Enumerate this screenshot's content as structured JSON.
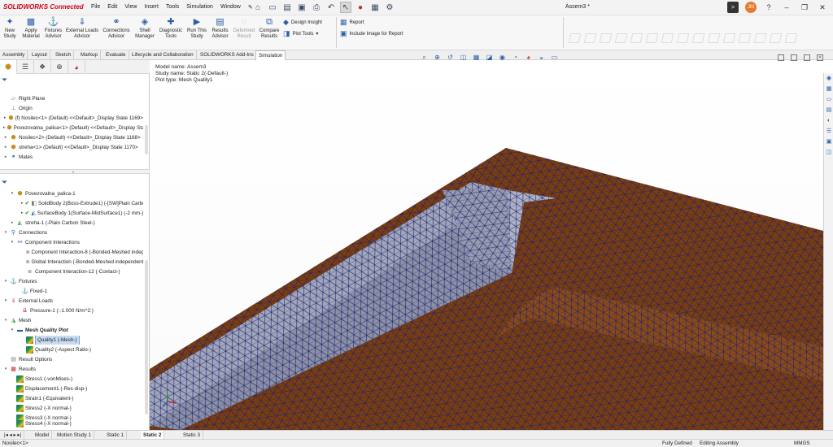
{
  "app": {
    "logo_text": "SOLIDWORKS Connected",
    "document_title": "Assem3 *"
  },
  "menu": [
    "File",
    "Edit",
    "View",
    "Insert",
    "Tools",
    "Simulation",
    "Window"
  ],
  "quick_tools": [
    "home-icon",
    "new-doc-icon",
    "open-icon",
    "save-icon",
    "print-icon",
    "undo-icon",
    "select-icon",
    "traffic-light-icon",
    "rebuild-icon",
    "options-icon"
  ],
  "window_controls": {
    "avatar": "JM"
  },
  "ribbon": {
    "buttons": [
      {
        "label": "New Study",
        "icon": "new-study-icon"
      },
      {
        "label": "Apply Material",
        "icon": "material-icon"
      },
      {
        "label": "Fixtures Advisor",
        "icon": "fixture-icon"
      },
      {
        "label": "External Loads Advisor",
        "icon": "load-icon"
      },
      {
        "label": "Connections Advisor",
        "icon": "connection-icon"
      },
      {
        "label": "Shell Manager",
        "icon": "shell-icon"
      },
      {
        "label": "Diagnostic Tools",
        "icon": "diagnostic-icon"
      },
      {
        "label": "Run This Study",
        "icon": "run-icon"
      },
      {
        "label": "Results Advisor",
        "icon": "results-icon"
      },
      {
        "label": "Deformed Result",
        "icon": "deformed-icon"
      },
      {
        "label": "Compare Results",
        "icon": "compare-icon"
      }
    ],
    "small": [
      {
        "label": "Design Insight",
        "icon": "insight-icon"
      },
      {
        "label": "Plot Tools",
        "icon": "plot-tools-icon"
      },
      {
        "label": "Report",
        "icon": "report-icon"
      },
      {
        "label": "Include Image for Report",
        "icon": "image-report-icon"
      }
    ]
  },
  "command_tabs": [
    "Assembly",
    "Layout",
    "Sketch",
    "Markup",
    "Evaluate",
    "Lifecycle and Collaboration",
    "SOLIDWORKS Add-Ins",
    "Simulation"
  ],
  "feature_tree": [
    {
      "label": "Right Plane",
      "icon": "plane-icon"
    },
    {
      "label": "Origin",
      "icon": "origin-icon"
    },
    {
      "label": "(f) Nosilec<1> (Default) <<Default>_Display State 1169>",
      "icon": "part-icon"
    },
    {
      "label": "Povezovalna_palica<1> (Default) <<Default>_Display State 1166>",
      "icon": "part-icon"
    },
    {
      "label": "Nosilec<2> (Default) <<Default>_Display State 1168>",
      "icon": "part-icon"
    },
    {
      "label": "streha<1> (Default) <<Default>_Display State 1170>",
      "icon": "part-icon"
    },
    {
      "label": "Mates",
      "icon": "mates-icon"
    }
  ],
  "study_tree": {
    "part_group": "Povezovalna_palica-1",
    "bodies": [
      "SolidBody 2(Boss-Extrude1) (-[SW]Plain Carbon Steel-)",
      "SurfaceBody 1(Surface-MidSurface1) (-2 mm-)"
    ],
    "streha": "streha-1 (-Plain Carbon Steel-)",
    "connections": "Connections",
    "component_interactions": "Component Interactions",
    "interactions": [
      "Component Interaction-8 (-Bonded-Meshed independently-)",
      "Global Interaction (-Bonded-Meshed independently-)",
      "Component Interaction-12 (-Contact-)"
    ],
    "fixtures": "Fixtures",
    "fixed": "Fixed-1",
    "external_loads": "External Loads",
    "pressure": "Pressure-1 (:-1.000 N/m^2:)",
    "mesh": "Mesh",
    "mesh_quality_plot": "Mesh Quality Plot",
    "qualities": [
      "Quality1 (-Mesh-)",
      "Quality2 (-Aspect Ratio-)"
    ],
    "result_options": "Result Options",
    "results": "Results",
    "result_items": [
      "Stress1 (-vonMises-)",
      "Displacement1 (-Res disp-)",
      "Strain1 (-Equivalent-)",
      "Stress2 (-X normal-)",
      "Stress3 (-X normal-)",
      "Stress4 (-X normal-)"
    ]
  },
  "viewport": {
    "model_name": "Model name: Assem3",
    "study_name": "Study name: Static 2(-Default-)",
    "plot_type": "Plot type: Mesh Quality1"
  },
  "colors": {
    "surface_brown": "#7a3d0d",
    "beam_gray": "#9a9fb0",
    "mesh_line": "#1a1f7a",
    "accent_blue": "#2a5fa6"
  },
  "bottom_tabs": [
    "Model",
    "Motion Study 1",
    "Static 1",
    "Static 2",
    "Static 3"
  ],
  "status": {
    "left": "Nosilec<1>",
    "defined": "Fully Defined",
    "mode": "Editing Assembly",
    "units": "MMGS"
  }
}
